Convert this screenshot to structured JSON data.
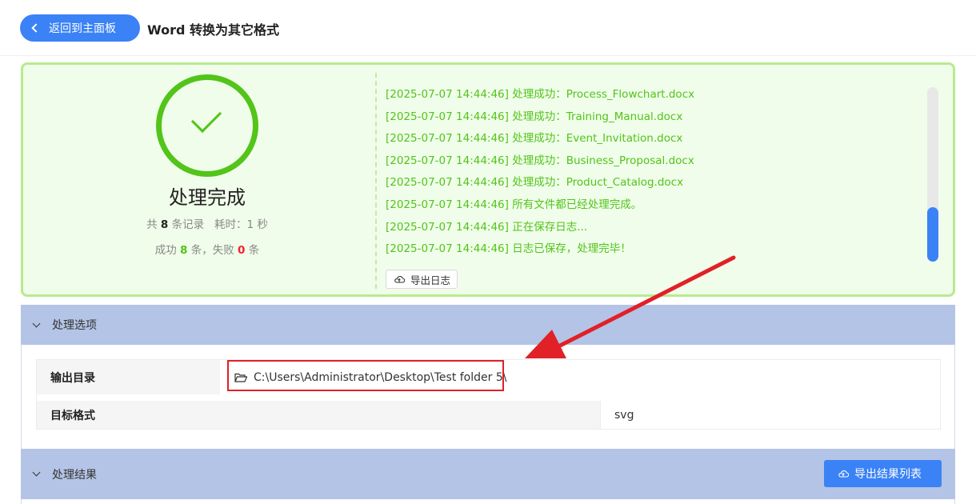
{
  "header": {
    "back_label": "返回到主面板",
    "title": "Word 转换为其它格式"
  },
  "status": {
    "title": "处理完成",
    "stats": {
      "total_prefix": "共",
      "total_count": "8",
      "total_suffix": "条记录",
      "elapsed_label": "耗时：1 秒",
      "success_prefix": "成功",
      "success_count": "8",
      "success_suffix": "条，失败",
      "fail_count": "0",
      "fail_suffix": "条"
    },
    "log": [
      "[2025-07-07 14:44:46] 处理成功：Process_Flowchart.docx",
      "[2025-07-07 14:44:46] 处理成功：Training_Manual.docx",
      "[2025-07-07 14:44:46] 处理成功：Event_Invitation.docx",
      "[2025-07-07 14:44:46] 处理成功：Business_Proposal.docx",
      "[2025-07-07 14:44:46] 处理成功：Product_Catalog.docx",
      "[2025-07-07 14:44:46] 所有文件都已经处理完成。",
      "[2025-07-07 14:44:46] 正在保存日志...",
      "[2025-07-07 14:44:46] 日志已保存，处理完毕！"
    ],
    "export_log_label": "导出日志",
    "log_scroll_position": 1.0
  },
  "options": {
    "section_label": "处理选项",
    "output_dir_label": "输出目录",
    "output_dir_value": "C:\\Users\\Administrator\\Desktop\\Test folder 5\\",
    "target_format_label": "目标格式",
    "target_format_value": "svg"
  },
  "results": {
    "section_label": "处理结果",
    "export_results_label": "导出结果列表"
  },
  "colors": {
    "accent": "#3b82f6",
    "success": "#52c41a",
    "fail": "#f5222d",
    "annotation": "#e12027",
    "section_header": "#b4c4e6"
  },
  "icons": {
    "back": "chevron-left-icon",
    "success": "check-circle-icon",
    "export": "cloud-upload-icon",
    "collapse": "chevron-down-icon",
    "folder": "folder-open-icon"
  }
}
